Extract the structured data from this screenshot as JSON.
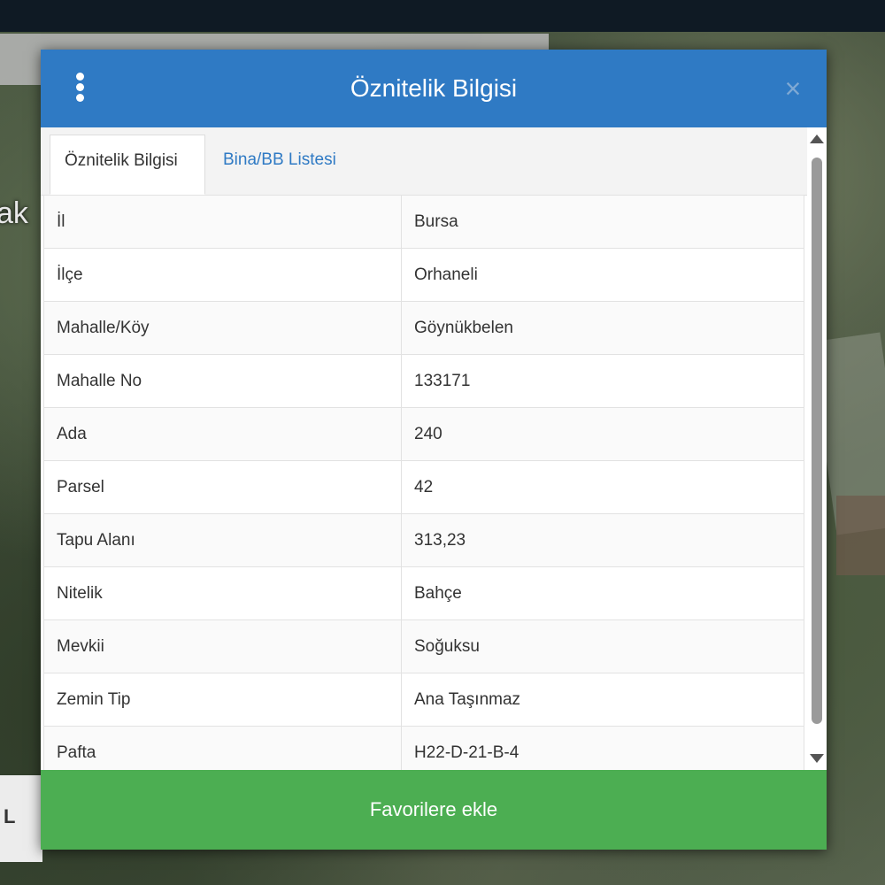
{
  "map": {
    "partial_label": "ak",
    "corner_badge": "L"
  },
  "dialog": {
    "title": "Öznitelik Bilgisi",
    "close_glyph": "×",
    "tabs": [
      {
        "label": "Öznitelik Bilgisi",
        "active": true
      },
      {
        "label": "Bina/BB Listesi",
        "active": false
      }
    ],
    "rows": [
      {
        "key": "İl",
        "value": "Bursa"
      },
      {
        "key": "İlçe",
        "value": "Orhaneli"
      },
      {
        "key": "Mahalle/Köy",
        "value": "Göynükbelen"
      },
      {
        "key": "Mahalle No",
        "value": "133171"
      },
      {
        "key": "Ada",
        "value": "240"
      },
      {
        "key": "Parsel",
        "value": "42"
      },
      {
        "key": "Tapu Alanı",
        "value": "313,23"
      },
      {
        "key": "Nitelik",
        "value": "Bahçe"
      },
      {
        "key": "Mevkii",
        "value": "Soğuksu"
      },
      {
        "key": "Zemin Tip",
        "value": "Ana Taşınmaz"
      },
      {
        "key": "Pafta",
        "value": "H22-D-21-B-4"
      }
    ],
    "favorite_button": "Favorilere ekle",
    "colors": {
      "header": "#2f7ac4",
      "favorite": "#4cae52"
    }
  }
}
